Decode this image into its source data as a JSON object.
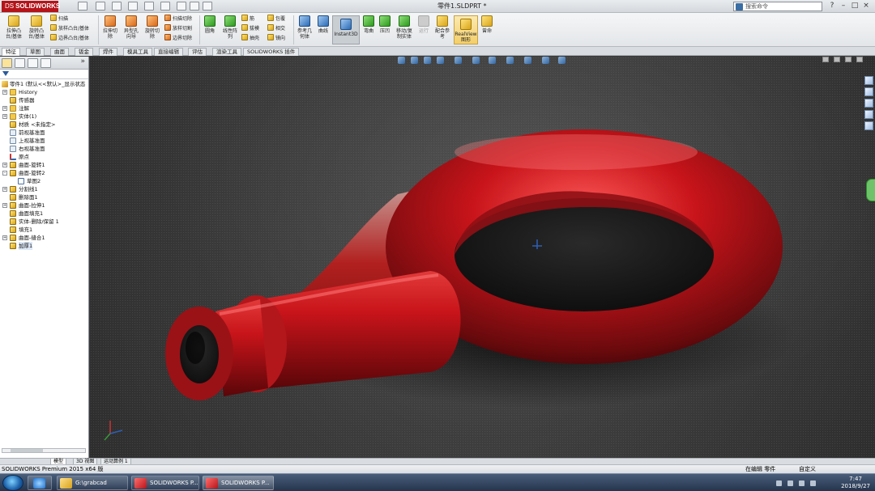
{
  "app": {
    "logo": "SOLIDWORKS",
    "logo_prefix": "DS",
    "document_title": "零件1.SLDPRT *",
    "search_placeholder": "搜索命令",
    "window_controls": [
      "?",
      "–",
      "□",
      "×"
    ]
  },
  "ribbon": {
    "large_buttons": [
      {
        "label": "拉伸凸\n台/基体",
        "icon": "extrude-boss-icon"
      },
      {
        "label": "旋转凸\n台/基体",
        "icon": "revolve-boss-icon"
      },
      {
        "label": "拉伸切\n除",
        "icon": "extrude-cut-icon"
      },
      {
        "label": "异型孔\n向导",
        "icon": "hole-wizard-icon"
      },
      {
        "label": "旋转切\n除",
        "icon": "revolve-cut-icon"
      },
      {
        "label": "圆角",
        "icon": "fillet-icon"
      },
      {
        "label": "线性阵\n列",
        "icon": "linear-pattern-icon"
      },
      {
        "label": "参考几\n何体",
        "icon": "reference-geometry-icon"
      },
      {
        "label": "曲线",
        "icon": "curves-icon"
      },
      {
        "label": "Instant3D",
        "icon": "instant3d-icon"
      },
      {
        "label": "弯曲",
        "icon": "flex-icon"
      },
      {
        "label": "压凹",
        "icon": "indent-icon"
      },
      {
        "label": "移动/复\n制实体",
        "icon": "move-copy-body-icon"
      },
      {
        "label": "运行",
        "icon": "run-icon"
      },
      {
        "label": "配合参\n考",
        "icon": "mate-reference-icon"
      },
      {
        "label": "RealView\n图形",
        "icon": "realview-icon"
      },
      {
        "label": "曾命",
        "icon": "extra-icon"
      }
    ],
    "small_group_1": [
      "扫描",
      "放样凸台/基体",
      "边界凸台/基体"
    ],
    "small_group_2": [
      "扫描切除",
      "放样切割",
      "边界切除"
    ],
    "small_group_3": [
      "筋",
      "拔模",
      "抽壳"
    ],
    "small_group_4": [
      "包覆",
      "相交",
      "镜向"
    ]
  },
  "command_tabs": [
    "特征",
    "草图",
    "曲面",
    "钣金",
    "焊件",
    "模具工具",
    "直接编辑",
    "评估",
    "渲染工具",
    "SOLIDWORKS 插件"
  ],
  "feature_tree": {
    "root": "零件1 (默认<<默认>_显示状态",
    "items": [
      {
        "label": "History",
        "icon": "folder-icon",
        "expand": "+"
      },
      {
        "label": "传感器",
        "icon": "sensor-icon",
        "expand": ""
      },
      {
        "label": "注解",
        "icon": "annotation-icon",
        "expand": "+"
      },
      {
        "label": "实体(1)",
        "icon": "solid-bodies-icon",
        "expand": "+"
      },
      {
        "label": "材质 <未指定>",
        "icon": "material-icon",
        "expand": ""
      },
      {
        "label": "前视基准面",
        "icon": "plane-icon",
        "expand": ""
      },
      {
        "label": "上视基准面",
        "icon": "plane-icon",
        "expand": ""
      },
      {
        "label": "右视基准面",
        "icon": "plane-icon",
        "expand": ""
      },
      {
        "label": "原点",
        "icon": "origin-icon",
        "expand": ""
      },
      {
        "label": "曲面-旋转1",
        "icon": "surface-revolve-icon",
        "expand": "+"
      },
      {
        "label": "曲面-旋转2",
        "icon": "surface-revolve-icon",
        "expand": "–"
      },
      {
        "label": "草图2",
        "icon": "sketch-icon",
        "expand": "",
        "indent": 1
      },
      {
        "label": "分割线1",
        "icon": "split-line-icon",
        "expand": "+"
      },
      {
        "label": "删除面1",
        "icon": "delete-face-icon",
        "expand": ""
      },
      {
        "label": "曲面-拉伸1",
        "icon": "surface-extrude-icon",
        "expand": "+"
      },
      {
        "label": "曲面填充1",
        "icon": "surface-fill-icon",
        "expand": ""
      },
      {
        "label": "实体-删除/保留 1",
        "icon": "body-delete-icon",
        "expand": ""
      },
      {
        "label": "填充1",
        "icon": "fill-icon",
        "expand": ""
      },
      {
        "label": "曲面-缝合1",
        "icon": "surface-knit-icon",
        "expand": "+"
      },
      {
        "label": "加厚1",
        "icon": "thicken-icon",
        "expand": "",
        "selected": true
      }
    ]
  },
  "model_tabs": [
    "模型",
    "3D 视图",
    "运动算例 1"
  ],
  "status": {
    "left": "SOLIDWORKS Premium 2015 x64 版",
    "mode": "在编辑 零件",
    "units": "自定义"
  },
  "taskbar": {
    "items": [
      {
        "label": "G:\\grabcad",
        "icon": "folder-icon"
      },
      {
        "label": "SOLIDWORKS P...",
        "icon": "solidworks-icon"
      },
      {
        "label": "SOLIDWORKS P...",
        "icon": "solidworks-icon"
      }
    ],
    "time": "7:47",
    "date": "2018/9/27"
  },
  "colors": {
    "model_red": "#c8141a",
    "brand_red": "#b4141a",
    "viewport_bg": "#3a3a3a"
  }
}
